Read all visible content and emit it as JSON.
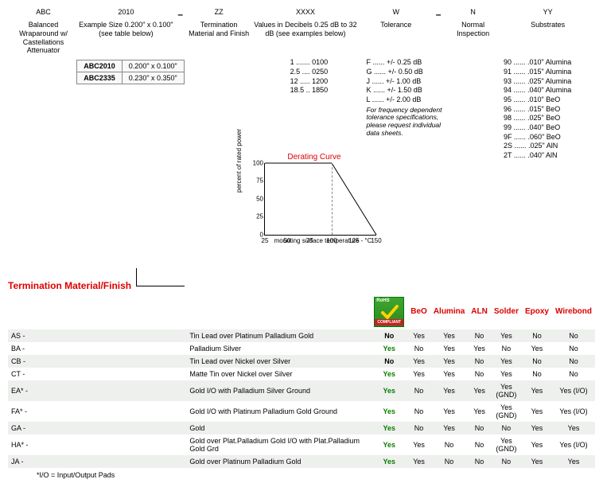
{
  "part": {
    "cols": [
      {
        "code": "ABC",
        "sub": "Balanced Wraparound w/ Castellations Attenuator",
        "w": 90
      },
      {
        "code": "2010",
        "sub": "Example Size 0.200\" x 0.100\" (see table below)",
        "w": 120
      },
      {
        "code": "ZZ",
        "sub": "Termination Material and Finish",
        "w": 80
      },
      {
        "code": "XXXX",
        "sub": "Values in Decibels 0.25 dB to 32 dB (see examples below)",
        "w": 140
      },
      {
        "code": "W",
        "sub": "Tolerance",
        "w": 90
      },
      {
        "code": "N",
        "sub": "Normal Inspection",
        "w": 70
      },
      {
        "code": "YY",
        "sub": "Substrates",
        "w": 120
      }
    ],
    "dashes": [
      2,
      5
    ]
  },
  "size_table": [
    {
      "pn": "ABC2010",
      "dim": "0.200\" x 0.100\""
    },
    {
      "pn": "ABC2335",
      "dim": "0.230\" x 0.350\""
    }
  ],
  "db_examples": [
    "1 ....... 0100",
    "2.5 .... 0250",
    "12 ..... 1200",
    "18.5 .. 1850"
  ],
  "tolerances": [
    "F ...... +/- 0.25 dB",
    "G ...... +/- 0.50 dB",
    "J ...... +/- 1.00 dB",
    "K ...... +/- 1.50 dB",
    "L ...... +/- 2.00 dB"
  ],
  "tol_note": "For frequency dependent tolerance specifications, please request individual data sheets.",
  "substrates": [
    "90 ...... .010\" Alumina",
    "91 ...... .015\" Alumina",
    "93 ...... .025\" Alumina",
    "94 ...... .040\" Alumina",
    "95 ...... .010\" BeO",
    "96 ...... .015\" BeO",
    "98 ...... .025\" BeO",
    "99 ...... .040\" BeO",
    "9F ...... .060\" BeO",
    "2S ...... .025\" AlN",
    "2T ...... .040\" AlN"
  ],
  "chart_data": {
    "type": "line",
    "title": "Derating Curve",
    "xlabel": "mounting surface temperature - °C",
    "ylabel": "percent of rated power",
    "x": [
      25,
      100,
      150
    ],
    "y": [
      100,
      100,
      0
    ],
    "xlim": [
      25,
      150
    ],
    "ylim": [
      0,
      100
    ],
    "xticks": [
      25,
      50,
      75,
      100,
      125,
      150
    ],
    "yticks": [
      0,
      25,
      50,
      75,
      100
    ],
    "vline": 100
  },
  "mat_section_title": "Termination Material/Finish",
  "mat_headers": [
    "",
    "",
    "RoHS",
    "BeO",
    "Alumina",
    "ALN",
    "Solder",
    "Epoxy",
    "Wirebond"
  ],
  "rohs_badge": {
    "top": "RoHS",
    "bottom": "COMPLIANT"
  },
  "materials": [
    {
      "code": "AS -",
      "desc": "Tin Lead over Platinum Palladium Gold",
      "rohs": "No",
      "v": [
        "Yes",
        "Yes",
        "No",
        "Yes",
        "No",
        "No"
      ]
    },
    {
      "code": "BA -",
      "desc": "Palladium Silver",
      "rohs": "Yes",
      "v": [
        "No",
        "Yes",
        "Yes",
        "No",
        "Yes",
        "No"
      ]
    },
    {
      "code": "CB -",
      "desc": "Tin Lead over Nickel over Silver",
      "rohs": "No",
      "v": [
        "Yes",
        "Yes",
        "No",
        "Yes",
        "No",
        "No"
      ]
    },
    {
      "code": "CT -",
      "desc": "Matte Tin over Nickel over Silver",
      "rohs": "Yes",
      "v": [
        "Yes",
        "Yes",
        "No",
        "Yes",
        "No",
        "No"
      ]
    },
    {
      "code": "EA* -",
      "desc": "Gold I/O with Palladium Silver Ground",
      "rohs": "Yes",
      "v": [
        "No",
        "Yes",
        "Yes",
        "Yes (GND)",
        "Yes",
        "Yes (I/O)"
      ]
    },
    {
      "code": "FA* -",
      "desc": "Gold I/O with Platinum Palladium Gold Ground",
      "rohs": "Yes",
      "v": [
        "No",
        "Yes",
        "Yes",
        "Yes (GND)",
        "Yes",
        "Yes (I/O)"
      ]
    },
    {
      "code": "GA -",
      "desc": "Gold",
      "rohs": "Yes",
      "v": [
        "No",
        "Yes",
        "No",
        "No",
        "Yes",
        "Yes"
      ]
    },
    {
      "code": "HA* -",
      "desc": "Gold over Plat.Palladium Gold I/O with Plat.Palladium Gold Grd",
      "rohs": "Yes",
      "v": [
        "Yes",
        "No",
        "No",
        "Yes (GND)",
        "Yes",
        "Yes (I/O)"
      ]
    },
    {
      "code": "JA -",
      "desc": "Gold over Platinum Palladium Gold",
      "rohs": "Yes",
      "v": [
        "Yes",
        "No",
        "No",
        "No",
        "Yes",
        "Yes"
      ]
    }
  ],
  "footnote": "*I/O = Input/Output Pads"
}
